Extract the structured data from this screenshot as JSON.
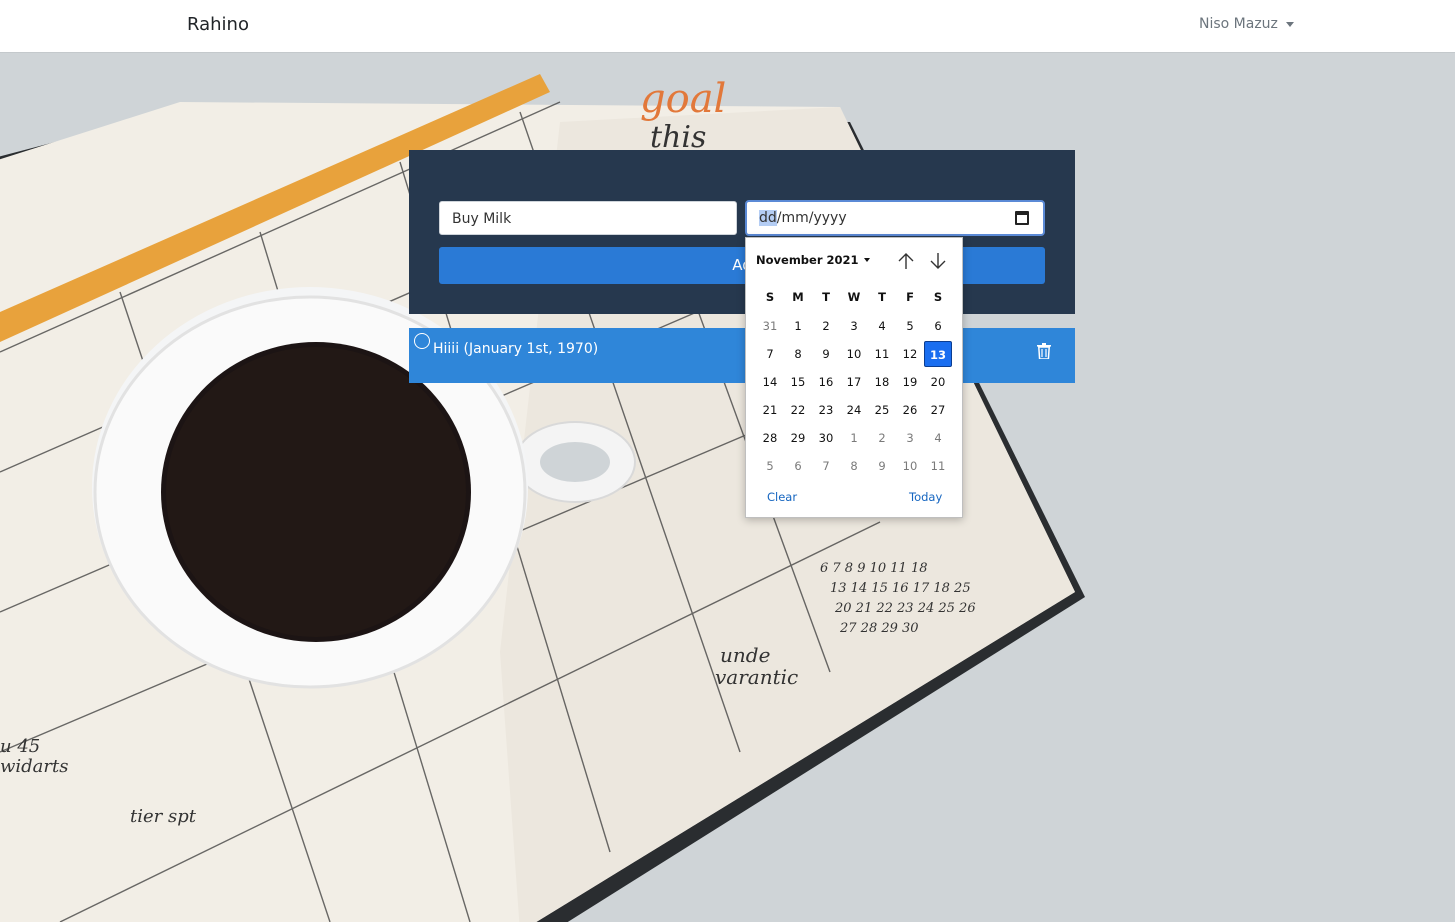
{
  "navbar": {
    "brand": "Rahino",
    "user": "Niso Mazuz"
  },
  "form": {
    "task_value": "Buy Milk",
    "date_placeholder": {
      "highlighted": "dd",
      "rest": "/mm/yyyy"
    },
    "add_button_label": "Ad"
  },
  "tasks": [
    {
      "text": "Hiiii (January 1st, 1970)"
    }
  ],
  "picker": {
    "month_label": "November 2021",
    "weekdays": [
      "S",
      "M",
      "T",
      "W",
      "T",
      "F",
      "S"
    ],
    "weeks": [
      [
        {
          "d": "31",
          "m": true
        },
        {
          "d": "1"
        },
        {
          "d": "2"
        },
        {
          "d": "3"
        },
        {
          "d": "4"
        },
        {
          "d": "5"
        },
        {
          "d": "6"
        }
      ],
      [
        {
          "d": "7"
        },
        {
          "d": "8"
        },
        {
          "d": "9"
        },
        {
          "d": "10"
        },
        {
          "d": "11"
        },
        {
          "d": "12"
        },
        {
          "d": "13",
          "sel": true
        }
      ],
      [
        {
          "d": "14"
        },
        {
          "d": "15"
        },
        {
          "d": "16"
        },
        {
          "d": "17"
        },
        {
          "d": "18"
        },
        {
          "d": "19"
        },
        {
          "d": "20"
        }
      ],
      [
        {
          "d": "21"
        },
        {
          "d": "22"
        },
        {
          "d": "23"
        },
        {
          "d": "24"
        },
        {
          "d": "25"
        },
        {
          "d": "26"
        },
        {
          "d": "27"
        }
      ],
      [
        {
          "d": "28"
        },
        {
          "d": "29"
        },
        {
          "d": "30"
        },
        {
          "d": "1",
          "m": true
        },
        {
          "d": "2",
          "m": true
        },
        {
          "d": "3",
          "m": true
        },
        {
          "d": "4",
          "m": true
        }
      ],
      [
        {
          "d": "5",
          "m": true
        },
        {
          "d": "6",
          "m": true
        },
        {
          "d": "7",
          "m": true
        },
        {
          "d": "8",
          "m": true
        },
        {
          "d": "9",
          "m": true
        },
        {
          "d": "10",
          "m": true
        },
        {
          "d": "11",
          "m": true
        }
      ]
    ],
    "clear_label": "Clear",
    "today_label": "Today"
  },
  "colors": {
    "panel": "#26384e",
    "accent": "#2a7ad6",
    "task_row": "#2f86d9",
    "selected_day": "#1a6ef0"
  }
}
